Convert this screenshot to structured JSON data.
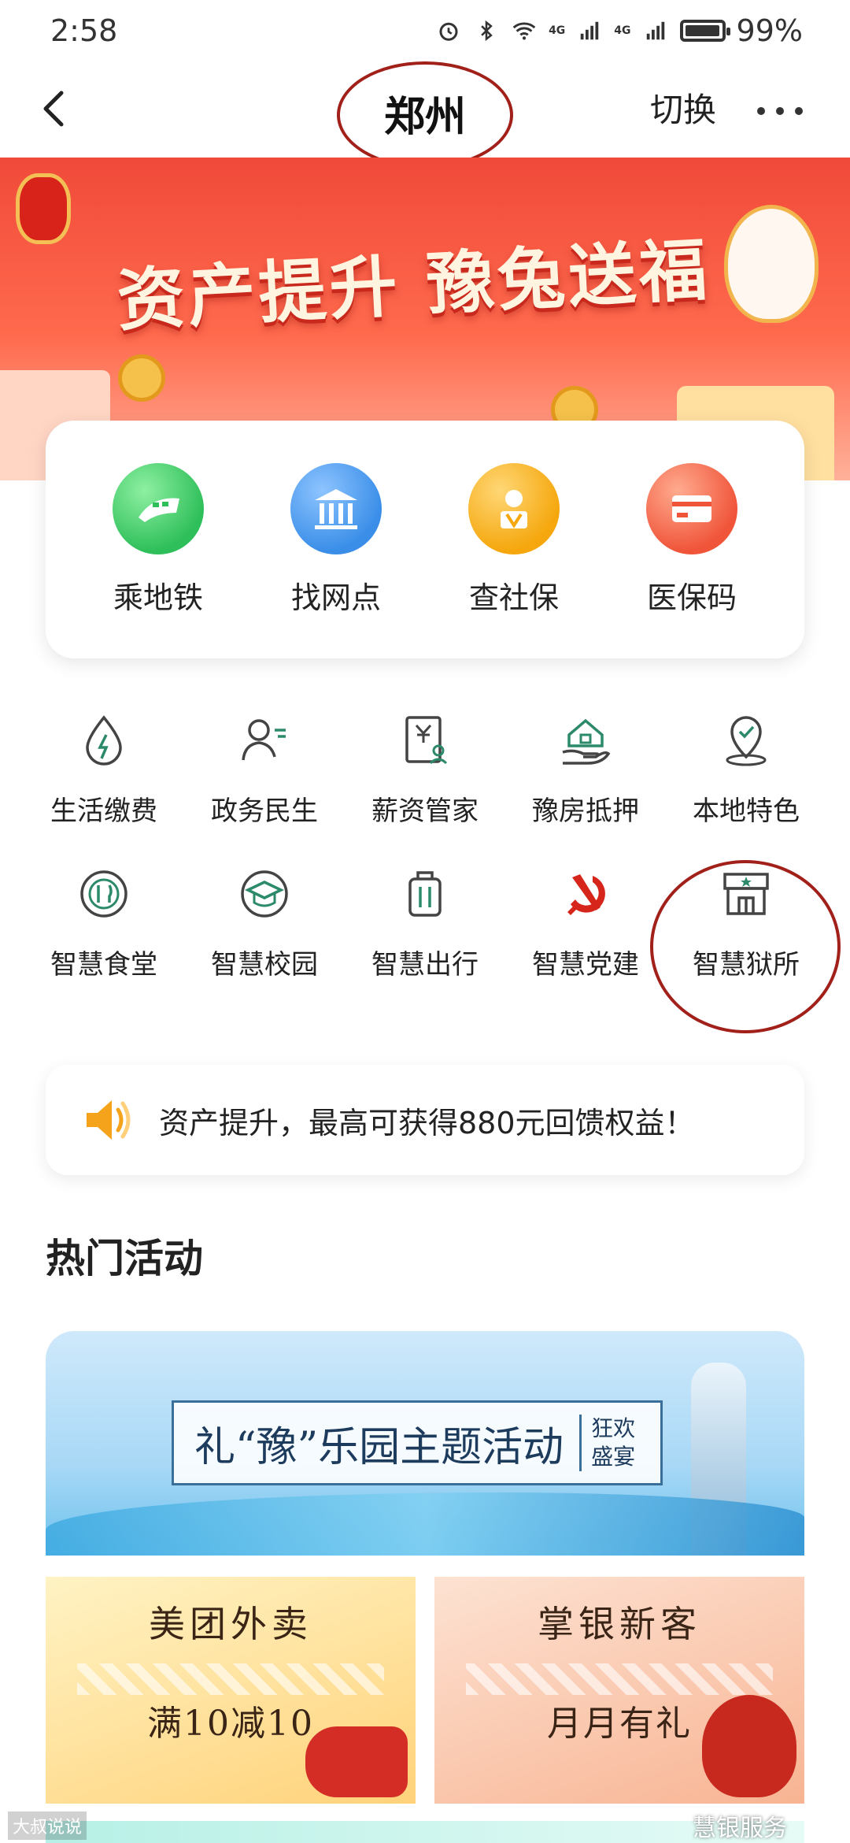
{
  "status_bar": {
    "time": "2:58",
    "battery": "99%",
    "battery_level": 0.99,
    "network1": "4G",
    "network2": "4G"
  },
  "nav": {
    "title": "郑州",
    "switch_label": "切换"
  },
  "banner": {
    "title": "资产提升 豫兔送福"
  },
  "quick_services": [
    {
      "label": "乘地铁",
      "icon": "train-icon",
      "color": "#2fbf5a"
    },
    {
      "label": "找网点",
      "icon": "bank-icon",
      "color": "#3a8ee8"
    },
    {
      "label": "查社保",
      "icon": "social-security-icon",
      "color": "#f5a70d"
    },
    {
      "label": "医保码",
      "icon": "card-icon",
      "color": "#f0553a"
    }
  ],
  "services_row1": [
    {
      "label": "生活缴费",
      "icon": "water-drop-icon"
    },
    {
      "label": "政务民生",
      "icon": "person-icon"
    },
    {
      "label": "薪资管家",
      "icon": "salary-doc-icon"
    },
    {
      "label": "豫房抵押",
      "icon": "house-hand-icon"
    },
    {
      "label": "本地特色",
      "icon": "location-pin-icon"
    }
  ],
  "services_row2": [
    {
      "label": "智慧食堂",
      "icon": "dining-icon"
    },
    {
      "label": "智慧校园",
      "icon": "graduation-cap-icon"
    },
    {
      "label": "智慧出行",
      "icon": "luggage-icon"
    },
    {
      "label": "智慧党建",
      "icon": "hammer-sickle-icon"
    },
    {
      "label": "智慧狱所",
      "icon": "building-icon"
    }
  ],
  "notice": {
    "text": "资产提升，最高可获得880元回馈权益！",
    "icon": "speaker-icon"
  },
  "section": {
    "title": "热门活动"
  },
  "activities": {
    "main_title": "礼“豫”乐园主题活动",
    "main_sub": "狂欢盛宴",
    "left_title": "美团外卖",
    "left_sub": "满10减10",
    "right_title": "掌银新客",
    "right_sub": "月月有礼"
  },
  "watermarks": {
    "left": "大叔说说",
    "right": "慧银服务"
  },
  "colors": {
    "accent_green": "#2c8a6a",
    "highlight_ring": "#a1201a"
  }
}
